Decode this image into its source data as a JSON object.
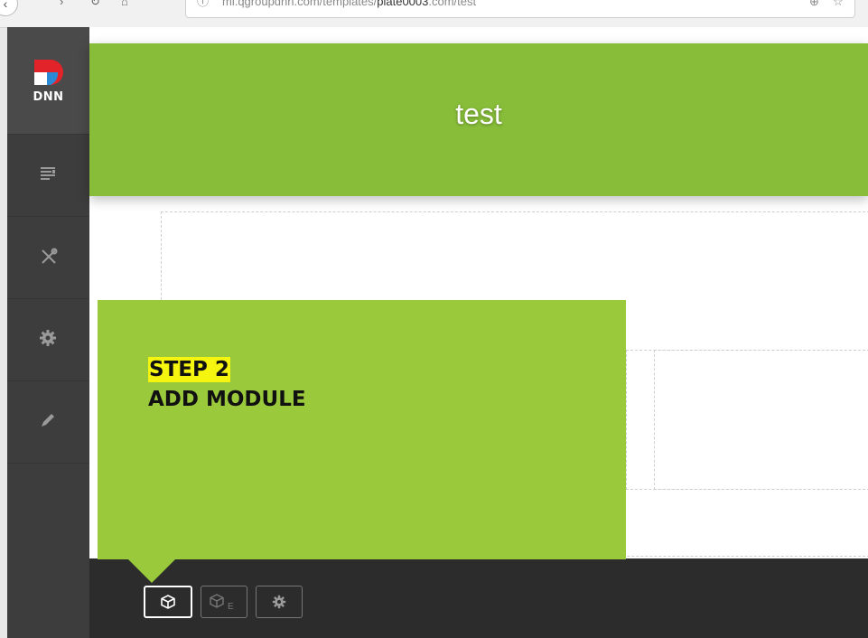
{
  "browser": {
    "url_prefix": "mi.qgroupdnn.com/templates/",
    "url_domain": "plate0003",
    "url_suffix": ".com/test"
  },
  "sidebar": {
    "logo_text": "DNN",
    "items": [
      {
        "icon": "content-icon"
      },
      {
        "icon": "tools-icon"
      },
      {
        "icon": "settings-icon"
      },
      {
        "icon": "edit-pencil-icon"
      }
    ]
  },
  "banner": {
    "title": "test"
  },
  "tour": {
    "step_label": "STEP 2",
    "step_title": "ADD MODULE"
  },
  "editbar": {
    "buttons": [
      {
        "icon": "module-cube-icon",
        "active": true
      },
      {
        "icon": "existing-module-icon",
        "active": false
      },
      {
        "icon": "gear-icon",
        "active": false
      }
    ]
  },
  "colors": {
    "banner": "#87bd39",
    "callout": "#9bc93c",
    "highlight": "#f5f50f",
    "sidebar": "#3d3d3d",
    "editbar": "#2c2c2c"
  }
}
